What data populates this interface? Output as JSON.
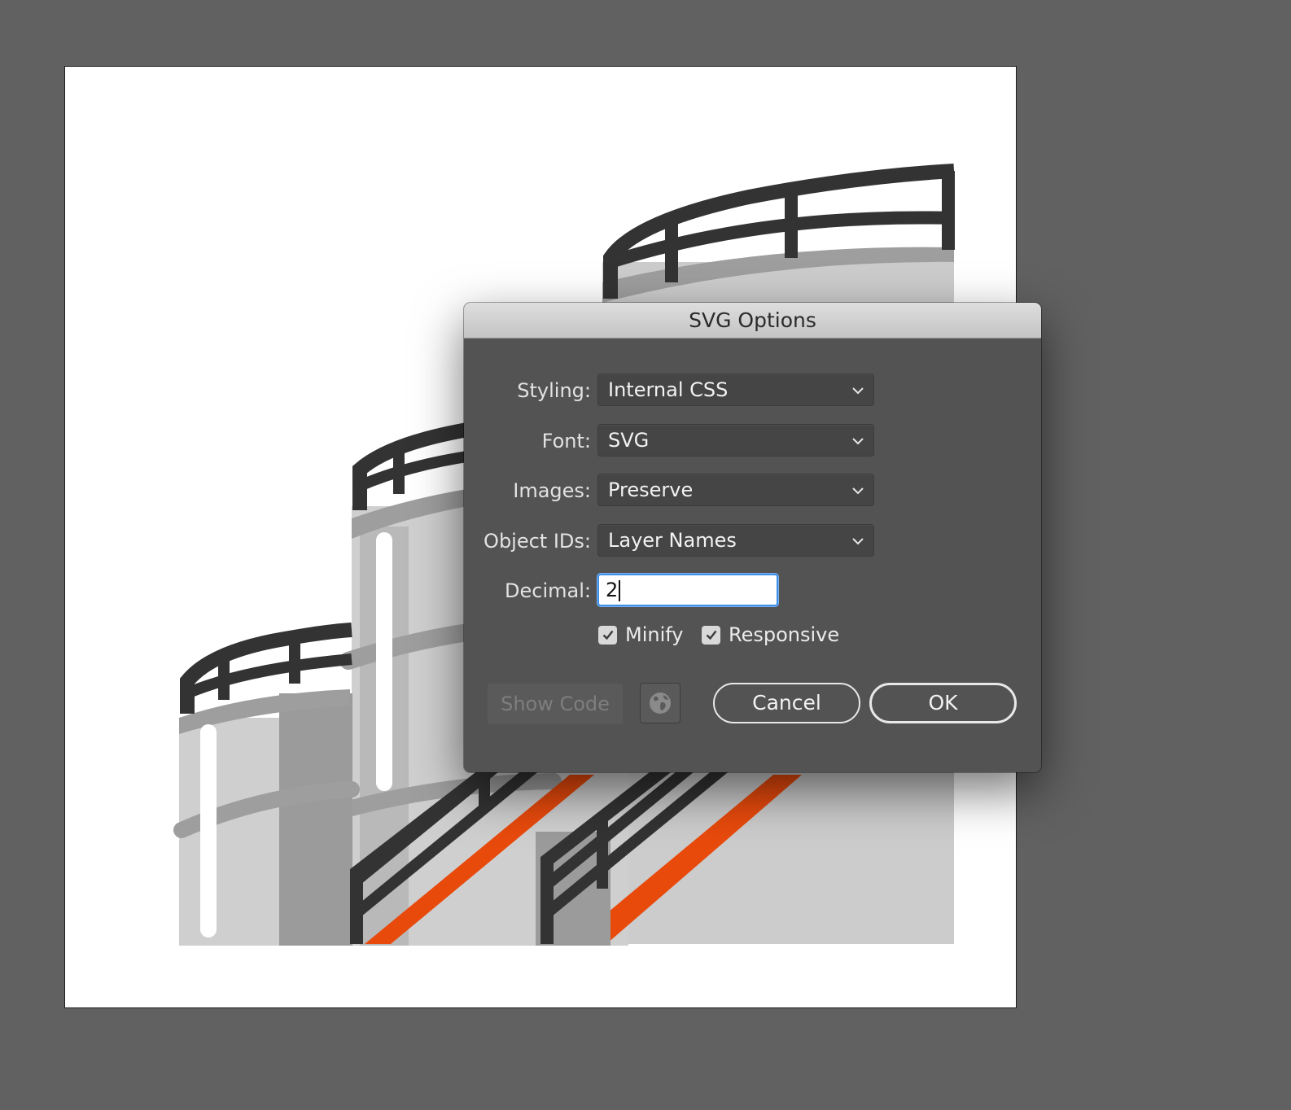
{
  "dialog": {
    "title": "SVG Options",
    "fields": {
      "styling": {
        "label": "Styling:",
        "value": "Internal CSS"
      },
      "font": {
        "label": "Font:",
        "value": "SVG"
      },
      "images": {
        "label": "Images:",
        "value": "Preserve"
      },
      "object_ids": {
        "label": "Object IDs:",
        "value": "Layer Names"
      },
      "decimal": {
        "label": "Decimal:",
        "value": "2"
      }
    },
    "checkboxes": {
      "minify": {
        "label": "Minify",
        "checked": true
      },
      "responsive": {
        "label": "Responsive",
        "checked": true
      }
    },
    "buttons": {
      "show_code": "Show Code",
      "cancel": "Cancel",
      "ok": "OK"
    },
    "icons": {
      "dropdown": "chevron-down-icon",
      "checkbox": "checkmark-icon",
      "web_preview": "globe-icon"
    }
  },
  "colors": {
    "workspace": "#616161",
    "artboard": "#ffffff",
    "dialog_bg": "#535353",
    "orange_accent": "#e84a0c",
    "focus_blue": "#3d8ee8"
  }
}
